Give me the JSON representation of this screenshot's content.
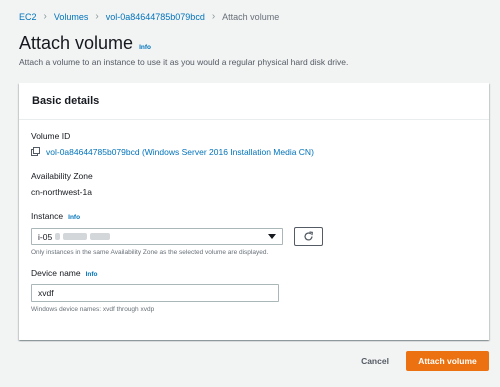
{
  "breadcrumb": {
    "items": [
      {
        "label": "EC2"
      },
      {
        "label": "Volumes"
      },
      {
        "label": "vol-0a84644785b079bcd"
      },
      {
        "label": "Attach volume"
      }
    ]
  },
  "header": {
    "title": "Attach volume",
    "info_label": "Info",
    "description": "Attach a volume to an instance to use it as you would a regular physical hard disk drive."
  },
  "panel": {
    "title": "Basic details",
    "volume_id": {
      "label": "Volume ID",
      "value": "vol-0a84644785b079bcd (Windows Server 2016 Installation Media CN)",
      "icon": "copy-icon"
    },
    "availability_zone": {
      "label": "Availability Zone",
      "value": "cn-northwest-1a"
    },
    "instance": {
      "label": "Instance",
      "info_label": "Info",
      "selected_value": "i-05",
      "hint": "Only instances in the same Availability Zone as the selected volume are displayed.",
      "refresh_icon": "refresh-icon"
    },
    "device_name": {
      "label": "Device name",
      "info_label": "Info",
      "value": "xvdf",
      "hint": "Windows device names: xvdf through xvdp"
    }
  },
  "footer": {
    "cancel_label": "Cancel",
    "submit_label": "Attach volume"
  },
  "colors": {
    "link": "#0073bb",
    "primary_button": "#ec7211",
    "background": "#f2f3f3"
  }
}
